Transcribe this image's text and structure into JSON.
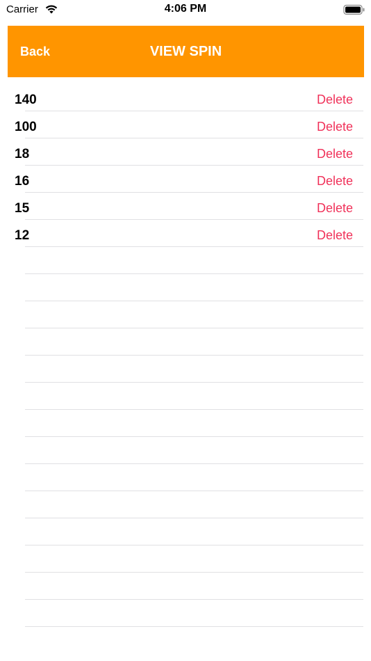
{
  "status_bar": {
    "carrier": "Carrier",
    "time": "4:06 PM"
  },
  "nav": {
    "back_label": "Back",
    "title": "VIEW SPIN",
    "color": "#ff9500"
  },
  "rows": [
    {
      "value": "140",
      "action": "Delete"
    },
    {
      "value": "100",
      "action": "Delete"
    },
    {
      "value": "18",
      "action": "Delete"
    },
    {
      "value": "16",
      "action": "Delete"
    },
    {
      "value": "15",
      "action": "Delete"
    },
    {
      "value": "12",
      "action": "Delete"
    }
  ],
  "empty_row_count": 14,
  "delete_color": "#f0325a"
}
